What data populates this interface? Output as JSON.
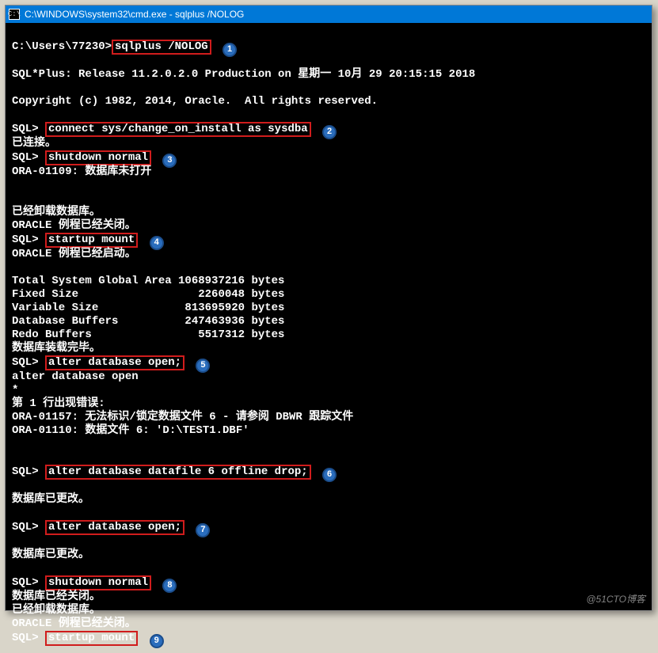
{
  "window": {
    "icon_label": "C:\\",
    "title": "C:\\WINDOWS\\system32\\cmd.exe - sqlplus  /NOLOG"
  },
  "lines": {
    "prompt1_pre": "C:\\Users\\77230>",
    "cmd1": "sqlplus /NOLOG",
    "badge1": "1",
    "release": "SQL*Plus: Release 11.2.0.2.0 Production on 星期一 10月 29 20:15:15 2018",
    "copyright": "Copyright (c) 1982, 2014, Oracle.  All rights reserved.",
    "sql_prompt": "SQL> ",
    "cmd2": "connect sys/change_on_install as sysdba",
    "badge2": "2",
    "connected": "已连接。",
    "cmd3": "shutdown normal",
    "badge3": "3",
    "ora01109": "ORA-01109: 数据库未打开",
    "dismounted": "已经卸载数据库。",
    "oracle_closed": "ORACLE 例程已经关闭。",
    "cmd4": "startup mount",
    "badge4": "4",
    "oracle_started": "ORACLE 例程已经启动。",
    "sga": "Total System Global Area 1068937216 bytes",
    "fixed": "Fixed Size                  2260048 bytes",
    "var": "Variable Size             813695920 bytes",
    "dbbuf": "Database Buffers          247463936 bytes",
    "redo": "Redo Buffers                5517312 bytes",
    "mounted": "数据库装载完毕。",
    "cmd5": "alter database open;",
    "badge5": "5",
    "echo5": "alter database open",
    "star": "*",
    "err_line": "第 1 行出现错误:",
    "ora01157": "ORA-01157: 无法标识/锁定数据文件 6 - 请参阅 DBWR 跟踪文件",
    "ora01110": "ORA-01110: 数据文件 6: 'D:\\TEST1.DBF'",
    "cmd6": "alter database datafile 6 offline drop;",
    "badge6": "6",
    "db_altered": "数据库已更改。",
    "cmd7": "alter database open;",
    "badge7": "7",
    "cmd8": "shutdown normal",
    "badge8": "8",
    "db_closed": "数据库已经关闭。",
    "cmd9": "startup mount",
    "badge9": "9"
  },
  "watermark": "@51CTO博客"
}
